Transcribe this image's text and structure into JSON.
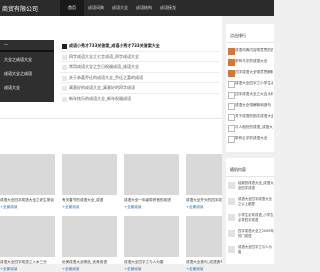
{
  "header": {
    "brand": "商贸有限公司",
    "nav": [
      "首页",
      "成语词典",
      "成语大全",
      "成语结构",
      "成语接龙"
    ]
  },
  "hero": {
    "lines": [
      "—",
      "大全之成语大全",
      "成语大全之成语",
      "成语大全"
    ]
  },
  "headlines": [
    "成语小秀才733关答案_成语小秀才733关答案大全",
    "四字成语大全之七言成语_四字成语大全",
    "常用成语大全之生日祝福成语_成语大全",
    "关于恭喜乔迁的成语大全_乔迁之喜的成语",
    "寓意好的成语大全_寓意好的四字成语",
    "新年快乐的成语大全_新年祝福成语"
  ],
  "cards": [
    {
      "title": "成语大全四字成语大全之老生常谈",
      "link": "+全景阅读"
    },
    {
      "title": "有关春节的成语大全_成语",
      "link": "+全景阅读"
    },
    {
      "title": "成语大全一年级带拼音的成语",
      "link": "+全景阅读"
    },
    {
      "title": "成语大全开头的四字成语",
      "link": "+全景阅读"
    },
    {
      "title": "成语大全四字成语之入木三分",
      "link": "+全景阅读"
    },
    {
      "title": "优美成语大全精选_优美成语",
      "link": "+全景阅读"
    },
    {
      "title": "成语大全四字之与人为善",
      "link": "+全景阅读"
    },
    {
      "title": "成语大全造句_成语造句",
      "link": "+全景阅读"
    }
  ],
  "sidebar": {
    "rank_title": "点击排行",
    "rank": [
      "成语词典内容带意思的四字成语",
      "带有马字的成语大全",
      "四字成语大全带意思解释",
      "成语大全四字之小学生必背",
      "四字成语大全之大吉大利",
      "成语大全带解释和造句",
      "关于成语的励志成语大全",
      "与人相处的成语_成语大全",
      "带有云字的成语大全"
    ],
    "related_title": "随机内容",
    "related": [
      "经典的成语大全_成语大全四字成语",
      "成语大全四字成语大全之以上都是",
      "小学生必背成语_小学生必背四字成语",
      "四字成语大全之2009年热门成语",
      "成语大全四字之与人为善"
    ]
  }
}
